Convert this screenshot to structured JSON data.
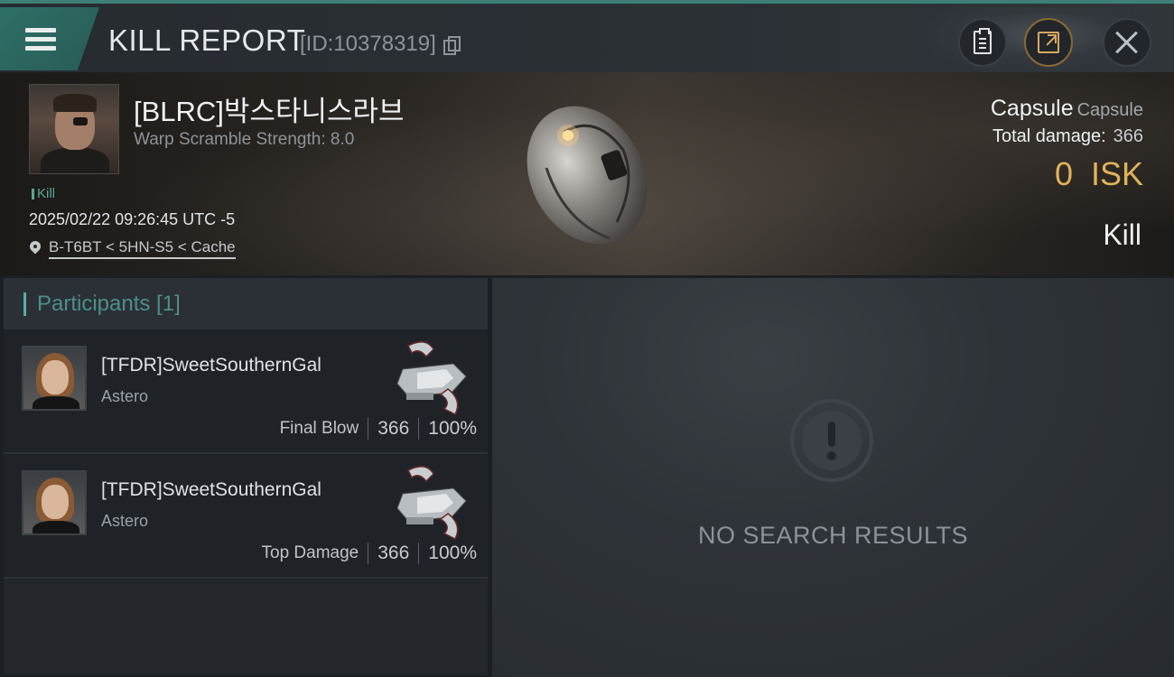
{
  "header": {
    "title": "KILL REPORT",
    "report_id": "[ID:10378319]",
    "icons": [
      "menu-icon",
      "copy-icon",
      "clipboard-icon",
      "share-icon",
      "close-icon"
    ]
  },
  "victim": {
    "name": "[BLRC]박스타니스라브",
    "warp_scramble": "Warp Scramble Strength: 8.0",
    "kill_tag": "Kill",
    "timestamp": "2025/02/22 09:26:45 UTC -5",
    "location": "B-T6BT < 5HN-S5 < Cache"
  },
  "ship": {
    "name": "Capsule",
    "class": "Capsule",
    "total_damage_label": "Total damage:",
    "total_damage": "366",
    "isk_value": "0",
    "isk_unit": "ISK",
    "result": "Kill"
  },
  "participants": {
    "header": "Participants [1]",
    "rows": [
      {
        "name": "[TFDR]SweetSouthernGal",
        "ship": "Astero",
        "role": "Final Blow",
        "damage": "366",
        "percent": "100%"
      },
      {
        "name": "[TFDR]SweetSouthernGal",
        "ship": "Astero",
        "role": "Top Damage",
        "damage": "366",
        "percent": "100%"
      }
    ]
  },
  "results": {
    "empty_text": "NO SEARCH RESULTS"
  },
  "colors": {
    "accent": "#3d7f76",
    "isk": "#e0b25a",
    "tag": "#56a89b"
  }
}
